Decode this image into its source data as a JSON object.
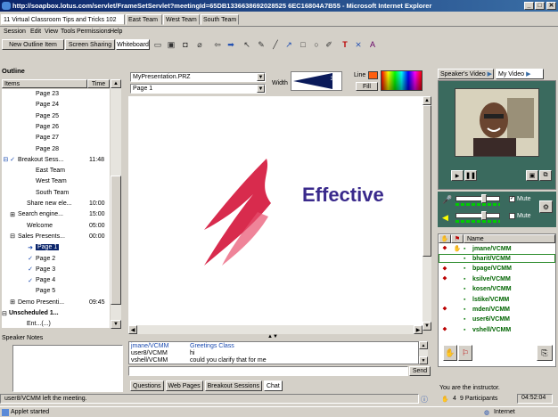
{
  "window": {
    "title": "http://soapbox.lotus.com/servlet/FrameSetServlet?meetingId=65DB1336638692028525 6EC16804A7B55 - Microsoft Internet Explorer",
    "controls": [
      "_",
      "□",
      "✕"
    ]
  },
  "tabs": [
    "11 Virtual Classroom Tips and Tricks 102",
    "East Team",
    "West Team",
    "South Team"
  ],
  "menu": [
    "Session",
    "Edit",
    "View",
    "Tools",
    "Permissions",
    "Help"
  ],
  "toolbar": {
    "new_outline": "New Outline Item",
    "screen_sharing": "Screen Sharing",
    "whiteboard": "Whiteboard"
  },
  "outline": {
    "title": "Outline",
    "col_items": "Items",
    "col_time": "Time",
    "rows": [
      {
        "label": "Page 23",
        "time": "",
        "indent": 3,
        "mark": ""
      },
      {
        "label": "Page 24",
        "time": "",
        "indent": 3,
        "mark": ""
      },
      {
        "label": "Page 25",
        "time": "",
        "indent": 3,
        "mark": ""
      },
      {
        "label": "Page 26",
        "time": "",
        "indent": 3,
        "mark": ""
      },
      {
        "label": "Page 27",
        "time": "",
        "indent": 3,
        "mark": ""
      },
      {
        "label": "Page 28",
        "time": "",
        "indent": 3,
        "mark": ""
      },
      {
        "label": "Breakout Sess...",
        "time": "11:48",
        "indent": 1,
        "mark": "⊟ ✓"
      },
      {
        "label": "East Team",
        "time": "",
        "indent": 3,
        "mark": ""
      },
      {
        "label": "West Team",
        "time": "",
        "indent": 3,
        "mark": ""
      },
      {
        "label": "South Team",
        "time": "",
        "indent": 3,
        "mark": ""
      },
      {
        "label": "Share new ele...",
        "time": "10:00",
        "indent": 2,
        "mark": ""
      },
      {
        "label": "Search engine...",
        "time": "15:00",
        "indent": 1,
        "mark": "⊞"
      },
      {
        "label": "Welcome",
        "time": "05:00",
        "indent": 2,
        "mark": ""
      },
      {
        "label": "Sales Presents...",
        "time": "00:00",
        "indent": 1,
        "mark": "⊟"
      },
      {
        "label": "Page 1",
        "time": "",
        "indent": 3,
        "mark": "➜",
        "selected": true
      },
      {
        "label": "Page 2",
        "time": "",
        "indent": 3,
        "mark": "✓"
      },
      {
        "label": "Page 3",
        "time": "",
        "indent": 3,
        "mark": "✓"
      },
      {
        "label": "Page 4",
        "time": "",
        "indent": 3,
        "mark": "✓"
      },
      {
        "label": "Page 5",
        "time": "",
        "indent": 3,
        "mark": ""
      },
      {
        "label": "Demo Presenti...",
        "time": "09:45",
        "indent": 1,
        "mark": "⊞"
      },
      {
        "label": "Unscheduled 1...",
        "time": "",
        "indent": 0,
        "mark": "⊟",
        "bold": true
      },
      {
        "label": "Ent...(...)",
        "time": "",
        "indent": 2,
        "mark": ""
      }
    ]
  },
  "speaker_notes": {
    "title": "Speaker Notes"
  },
  "presentation": {
    "file": "MyPresentation.PRZ",
    "page": "Page 1",
    "width_label": "Width",
    "width_value": "3",
    "line_label": "Line",
    "fill_label": "Fill"
  },
  "slide": {
    "text": "Effective"
  },
  "chat": {
    "messages": [
      {
        "user": "jmane/VCMM",
        "text": "Greetings Class"
      },
      {
        "user": "user8/VCMM",
        "text": "hi"
      },
      {
        "user": "vshell/VCMM",
        "text": "could you clarify that for me"
      }
    ],
    "send": "Send"
  },
  "bottom_tabs": [
    "Questions",
    "Web Pages",
    "Breakout Sessions",
    "Chat"
  ],
  "video_tabs": [
    "Speaker's Video",
    "My Video"
  ],
  "audio": {
    "mute1": "Mute",
    "mute2": "Mute"
  },
  "participants": {
    "col_name": "Name",
    "list": [
      {
        "name": "jmane/VCMM",
        "mark": "⬥",
        "hand": "✋"
      },
      {
        "name": "bharit/VCMM",
        "mark": "",
        "hand": "",
        "boxed": true
      },
      {
        "name": "bpage/VCMM",
        "mark": "⬥",
        "hand": ""
      },
      {
        "name": "ksilve/VCMM",
        "mark": "⬥",
        "hand": ""
      },
      {
        "name": "kosen/VCMM",
        "mark": "",
        "hand": ""
      },
      {
        "name": "lstike/VCMM",
        "mark": "",
        "hand": ""
      },
      {
        "name": "mden/VCMM",
        "mark": "⬥",
        "hand": ""
      },
      {
        "name": "user6/VCMM",
        "mark": "",
        "hand": ""
      },
      {
        "name": "vshell/VCMM",
        "mark": "⬥",
        "hand": ""
      }
    ],
    "instructor": "You are the instructor."
  },
  "statusbar": {
    "message": "user8/VCMM left the meeting.",
    "count": "4",
    "participants": "9 Participants",
    "time": "04:52:04"
  },
  "browser_status": {
    "left": "Applet started",
    "right": "Internet"
  },
  "colors": {
    "titlebar": "#0a246a",
    "slide_text": "#3a2a8c",
    "green_text": "#006400",
    "red_logo": "#d4143a",
    "video_tab": "#3a6ea5"
  }
}
